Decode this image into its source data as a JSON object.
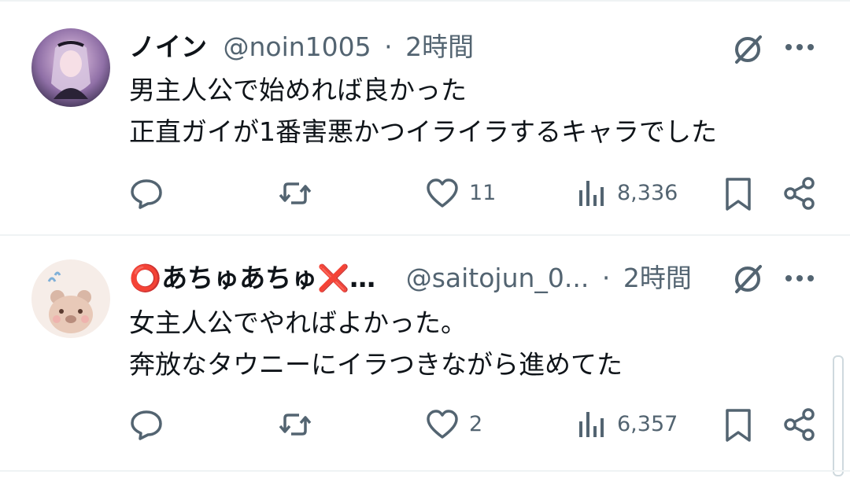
{
  "tweets": [
    {
      "name": "ノイン",
      "handle": "@noin1005",
      "separator": "·",
      "time": "2時間",
      "lines": [
        "男主人公で始めれば良かった",
        "正直ガイが1番害悪かつイライラするキャラでした"
      ],
      "replies": "",
      "retweets": "",
      "likes": "11",
      "views": "8,336",
      "avatar_icon": "anime-girl-avatar"
    },
    {
      "name": "⭕あちゅあちゅ❌…",
      "handle": "@saitojun_0...",
      "separator": "·",
      "time": "2時間",
      "lines": [
        "女主人公でやればよかった。",
        "奔放なタウニーにイラつきながら進めてた"
      ],
      "replies": "",
      "retweets": "",
      "likes": "2",
      "views": "6,357",
      "avatar_icon": "bear-avatar"
    }
  ],
  "icons": [
    "grok-icon",
    "more-icon",
    "reply-icon",
    "retweet-icon",
    "like-icon",
    "views-icon",
    "bookmark-icon",
    "share-icon"
  ]
}
